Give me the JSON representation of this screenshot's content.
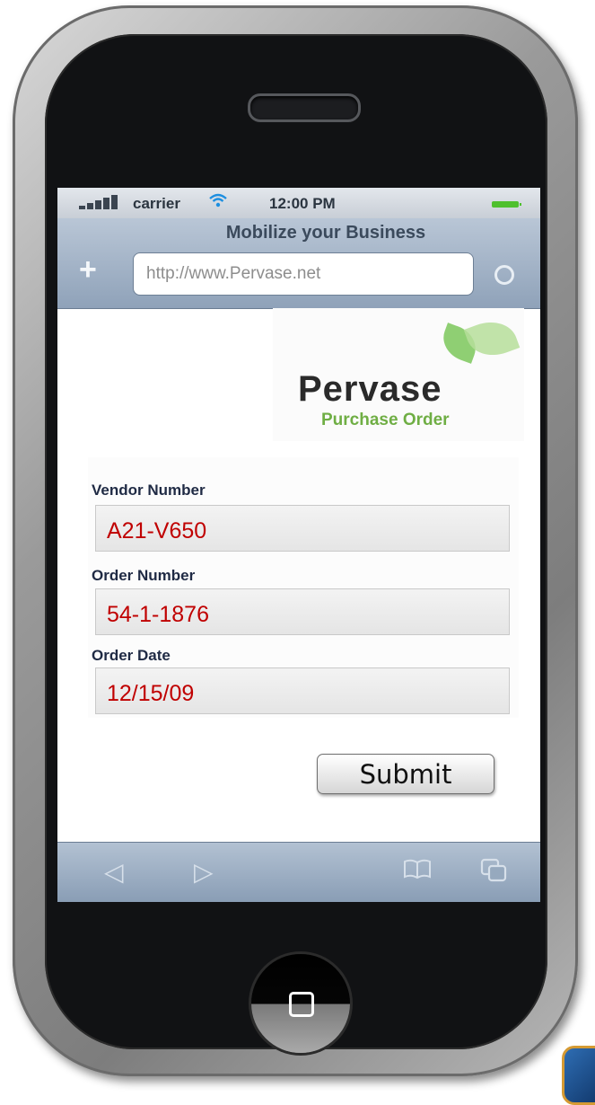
{
  "status_bar": {
    "carrier": "carrier",
    "time": "12:00 PM",
    "signal_icon": "signal-bars-icon",
    "wifi_icon": "wifi-icon",
    "battery_icon": "battery-icon"
  },
  "browser": {
    "title": "Mobilize your Business",
    "url_placeholder": "http://www.Pervase.net",
    "plus_glyph": "+",
    "reload_icon": "reload-icon"
  },
  "header": {
    "brand": "Pervase",
    "subtitle": "Purchase Order"
  },
  "form": {
    "fields": [
      {
        "label": "Vendor Number",
        "value": "A21-V650"
      },
      {
        "label": "Order Number",
        "value": "54-1-1876"
      },
      {
        "label": "Order Date",
        "value": "12/15/09"
      }
    ],
    "submit_label": "Submit",
    "value_color": "#c00000"
  },
  "toolbar": {
    "back_glyph": "◁",
    "forward_glyph": "▷",
    "bookmarks_icon": "bookmarks-icon",
    "pages_icon": "pages-icon"
  },
  "colors": {
    "brand_green": "#6fae44",
    "label_navy": "#1f2a44",
    "nav_blue": "#8fa2b9"
  }
}
